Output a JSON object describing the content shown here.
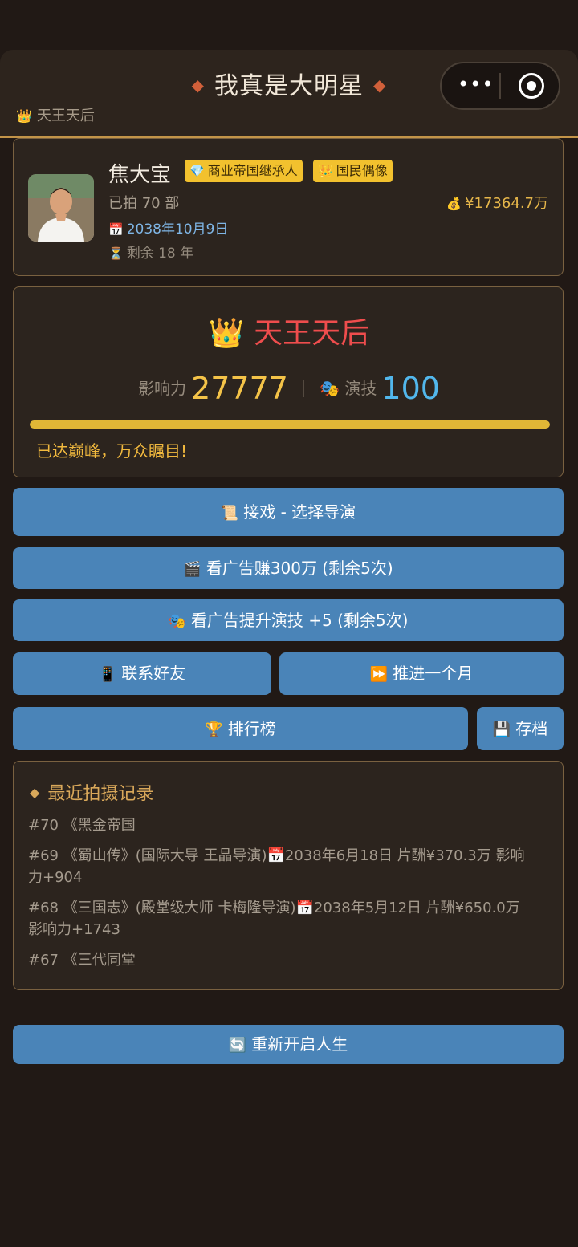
{
  "header": {
    "title": "我真是大明星",
    "subtitle": "天王天后"
  },
  "profile": {
    "name": "焦大宝",
    "tags": [
      "商业帝国继承人",
      "国民偶像"
    ],
    "films": "已拍 70 部",
    "money": "¥17364.7万",
    "date": "2038年10月9日",
    "remaining": "剩余 18 年"
  },
  "status": {
    "rank": "天王天后",
    "influence_label": "影响力",
    "influence_value": "27777",
    "acting_label": "演技",
    "acting_value": "100",
    "progress": 1.0,
    "peak_text": "已达巅峰，万众瞩目!"
  },
  "actions": {
    "take_role": "接戏 - 选择导演",
    "ad_money": "看广告赚300万 (剩余5次)",
    "ad_acting": "看广告提升演技 +5 (剩余5次)",
    "contact": "联系好友",
    "advance": "推进一个月",
    "ranking": "排行榜",
    "save": "存档",
    "restart": "重新开启人生"
  },
  "records": {
    "title": "最近拍摄记录",
    "items": [
      "#70 《黑金帝国",
      "#69 《蜀山传》(国际大导 王晶导演)📅2038年6月18日 片酬¥370.3万 影响力+904",
      "#68 《三国志》(殿堂级大师 卡梅隆导演)📅2038年5月12日 片酬¥650.0万 影响力+1743",
      "#67 《三代同堂"
    ]
  },
  "colors": {
    "accent_button": "#4a84b8",
    "rank": "#ef4d4d",
    "influence": "#f4c348",
    "acting": "#52b7ec",
    "tag": "#f2c12e"
  },
  "icons": {
    "crown": "crown-icon",
    "money_bag": "money-bag-icon",
    "calendar": "calendar-icon",
    "hourglass": "hourglass-icon",
    "masks": "theater-masks-icon",
    "scroll": "scroll-icon",
    "clapper": "clapper-icon",
    "phone": "phone-icon",
    "fast_forward": "fast-forward-icon",
    "trophy": "trophy-icon",
    "floppy": "floppy-disk-icon",
    "refresh": "refresh-icon"
  }
}
